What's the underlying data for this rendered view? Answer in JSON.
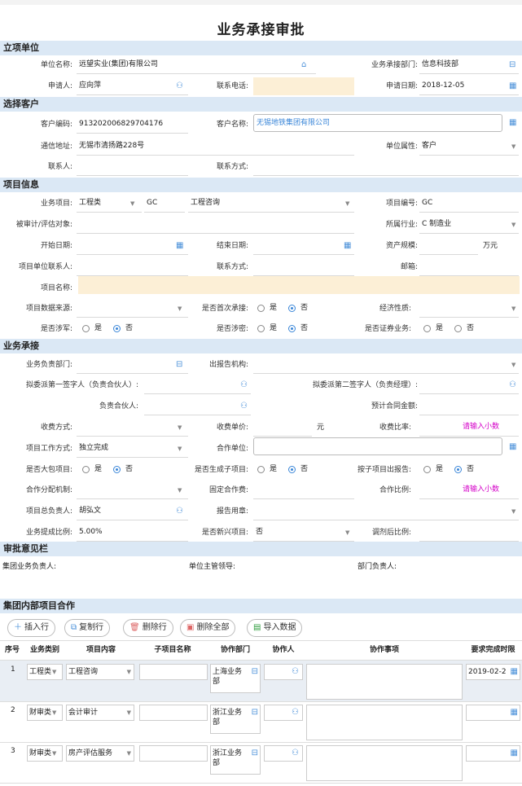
{
  "title": "业务承接审批",
  "sections": {
    "s1": "立项单位",
    "s2": "选择客户",
    "s3": "项目信息",
    "s4": "业务承接",
    "s5": "审批意见栏",
    "s6": "集团内部项目合作"
  },
  "f": {
    "unit_name_l": "单位名称:",
    "unit_name_v": "远望实业(集团)有限公司",
    "dept_l": "业务承接部门:",
    "dept_v": "信息科技部",
    "applicant_l": "申请人:",
    "applicant_v": "应向萍",
    "phone_l": "联系电话:",
    "apply_date_l": "申请日期:",
    "apply_date_v": "2018-12-05",
    "cust_code_l": "客户编码:",
    "cust_code_v": "913202006829704176",
    "cust_name_l": "客户名称:",
    "cust_name_v": "无锡地铁集团有限公司",
    "addr_l": "通信地址:",
    "addr_v": "无锡市清扬路228号",
    "unit_attr_l": "单位属性:",
    "unit_attr_v": "客户",
    "contact_l": "联系人:",
    "contact_way_l": "联系方式:",
    "biz_item_l": "业务项目:",
    "biz_item_v1": "工程类",
    "biz_item_v2": "GC",
    "biz_item_v3": "工程咨询",
    "proj_no_l": "项目编号:",
    "proj_no_v": "GC",
    "audited_l": "被审计/评估对象:",
    "industry_l": "所属行业:",
    "industry_v": "C 制造业",
    "start_l": "开始日期:",
    "end_l": "结束日期:",
    "asset_l": "资产规模:",
    "asset_unit": "万元",
    "proj_contact_l": "项目单位联系人:",
    "contact_way2_l": "联系方式:",
    "post_l": "邮箱:",
    "proj_name_l": "项目名称:",
    "source_l": "项目数据来源:",
    "first_l": "是否首次承接:",
    "econ_l": "经济性质:",
    "mil_l": "是否涉军:",
    "secret_l": "是否涉密:",
    "sec_l": "是否证券业务:",
    "yes": "是",
    "no": "否",
    "resp_dept_l": "业务负责部门:",
    "report_org_l": "出报告机构:",
    "sign1_l": "拟委派第一签字人（负责合伙人）:",
    "sign2_l": "拟委派第二签字人（负责经理）:",
    "partner_l": "负责合伙人:",
    "est_amount_l": "预计合同金额:",
    "fee_way_l": "收费方式:",
    "fee_price_l": "收费单价:",
    "fee_price_unit": "元",
    "fee_ratio_l": "收费比率:",
    "hint": "请输入小数",
    "work_way_l": "项目工作方式:",
    "work_way_v": "独立完成",
    "coop_unit_l": "合作单位:",
    "big_l": "是否大包项目:",
    "sub_l": "是否生成子项目:",
    "sub_report_l": "按子项目出报告:",
    "coop_mech_l": "合作分配机制:",
    "fixed_fee_l": "固定合作费:",
    "coop_ratio_l": "合作比例:",
    "pm_l": "项目总负责人:",
    "pm_v": "胡弘文",
    "report_use_l": "报告用章:",
    "comm_l": "业务提成比例:",
    "comm_v": "5.00%",
    "new_l": "是否新兴项目:",
    "new_v": "否",
    "adj_l": "调剂后比例:",
    "leader_l": "集团业务负责人:",
    "unit_leader_l": "单位主管领导:",
    "dept_leader_l": "部门负责人:"
  },
  "toolbar": {
    "insert": "插入行",
    "copy": "复制行",
    "delete": "删除行",
    "delete_all": "删除全部",
    "import": "导入数据"
  },
  "table": {
    "headers": [
      "序号",
      "业务类别",
      "项目内容",
      "子项目名称",
      "协作部门",
      "协作人",
      "协作事项",
      "要求完成时限"
    ],
    "rows": [
      {
        "no": "1",
        "cat": "工程类",
        "content": "工程咨询",
        "dept": "上海业务部",
        "date": "2019-02-2"
      },
      {
        "no": "2",
        "cat": "财审类",
        "content": "会计审计",
        "dept": "浙江业务部",
        "date": ""
      },
      {
        "no": "3",
        "cat": "财审类",
        "content": "房产评估服务",
        "dept": "浙江业务部",
        "date": ""
      }
    ]
  }
}
